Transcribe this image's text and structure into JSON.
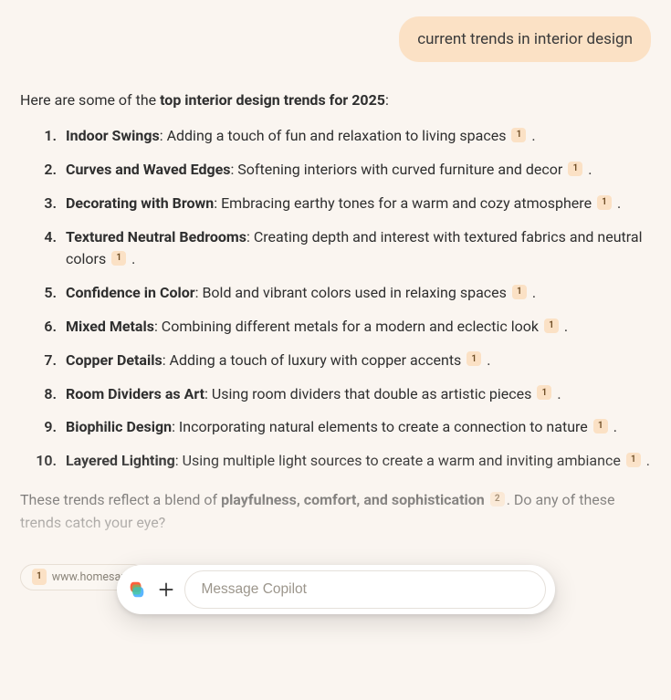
{
  "user_message": "current trends in interior design",
  "intro_prefix": "Here are some of the ",
  "intro_bold": "top interior design trends for 2025",
  "intro_suffix": ":",
  "trends": [
    {
      "title": "Indoor Swings",
      "desc": "Adding a touch of fun and relaxation to living spaces",
      "ref": "1"
    },
    {
      "title": "Curves and Waved Edges",
      "desc": "Softening interiors with curved furniture and decor",
      "ref": "1"
    },
    {
      "title": "Decorating with Brown",
      "desc": "Embracing earthy tones for a warm and cozy atmosphere",
      "ref": "1"
    },
    {
      "title": "Textured Neutral Bedrooms",
      "desc": "Creating depth and interest with textured fabrics and neutral colors",
      "ref": "1"
    },
    {
      "title": "Confidence in Color",
      "desc": "Bold and vibrant colors used in relaxing spaces",
      "ref": "1"
    },
    {
      "title": "Mixed Metals",
      "desc": "Combining different metals for a modern and eclectic look",
      "ref": "1"
    },
    {
      "title": "Copper Details",
      "desc": "Adding a touch of luxury with copper accents",
      "ref": "1"
    },
    {
      "title": "Room Dividers as Art",
      "desc": "Using room dividers that double as artistic pieces",
      "ref": "1"
    },
    {
      "title": "Biophilic Design",
      "desc": "Incorporating natural elements to create a connection to nature",
      "ref": "1"
    },
    {
      "title": "Layered Lighting",
      "desc": "Using multiple light sources to create a warm and inviting ambiance",
      "ref": "1"
    }
  ],
  "outro_prefix": "These trends reflect a blend of ",
  "outro_bold": "playfulness, comfort, and sophistication",
  "outro_ref": "2",
  "outro_suffix": ". Do any of these trends catch your eye?",
  "source_ref": "1",
  "source_domain": "www.homesand",
  "composer": {
    "placeholder": "Message Copilot"
  }
}
